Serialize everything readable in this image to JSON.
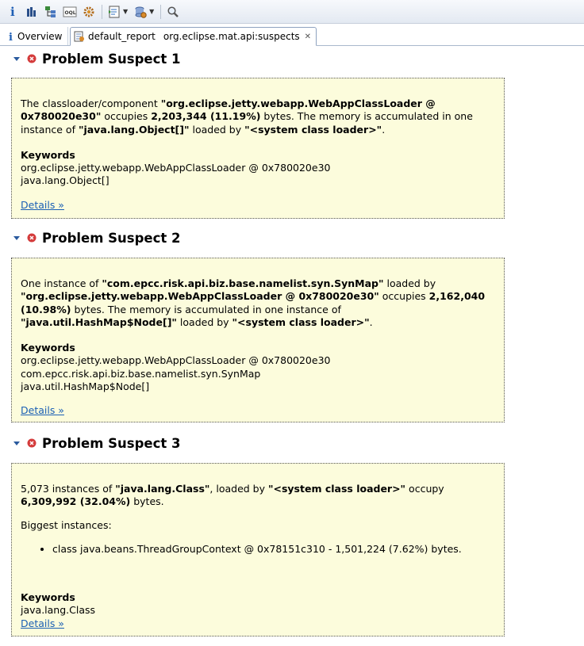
{
  "toolbar": {
    "icons": [
      "info-icon",
      "histogram-icon",
      "dominator-tree-icon",
      "oql-icon",
      "gear-icon",
      "query-browser-icon",
      "heap-dump-icon",
      "search-icon"
    ]
  },
  "tabs": {
    "overview": "Overview",
    "active": {
      "label": "default_report",
      "sublabel": "org.eclipse.mat.api:suspects"
    }
  },
  "suspects": [
    {
      "title": "Problem Suspect 1",
      "desc": [
        {
          "t": "The classloader/component ",
          "b": false
        },
        {
          "t": "\"org.eclipse.jetty.webapp.WebAppClassLoader @ 0x780020e30\"",
          "b": true
        },
        {
          "t": " occupies ",
          "b": false
        },
        {
          "t": "2,203,344 (11.19%)",
          "b": true
        },
        {
          "t": " bytes. The memory is accumulated in one instance of ",
          "b": false
        },
        {
          "t": "\"java.lang.Object[]\"",
          "b": true
        },
        {
          "t": " loaded by ",
          "b": false
        },
        {
          "t": "\"<system class loader>\"",
          "b": true
        },
        {
          "t": ".",
          "b": false
        }
      ],
      "keywords_title": "Keywords",
      "keywords": [
        "org.eclipse.jetty.webapp.WebAppClassLoader @ 0x780020e30",
        "java.lang.Object[]"
      ],
      "details": "Details »"
    },
    {
      "title": "Problem Suspect 2",
      "desc": [
        {
          "t": "One instance of ",
          "b": false
        },
        {
          "t": "\"com.epcc.risk.api.biz.base.namelist.syn.SynMap\"",
          "b": true
        },
        {
          "t": " loaded by ",
          "b": false
        },
        {
          "t": "\"org.eclipse.jetty.webapp.WebAppClassLoader @ 0x780020e30\"",
          "b": true
        },
        {
          "t": " occupies ",
          "b": false
        },
        {
          "t": "2,162,040 (10.98%)",
          "b": true
        },
        {
          "t": " bytes. The memory is accumulated in one instance of ",
          "b": false
        },
        {
          "t": "\"java.util.HashMap$Node[]\"",
          "b": true
        },
        {
          "t": " loaded by ",
          "b": false
        },
        {
          "t": "\"<system class loader>\"",
          "b": true
        },
        {
          "t": ".",
          "b": false
        }
      ],
      "keywords_title": "Keywords",
      "keywords": [
        "org.eclipse.jetty.webapp.WebAppClassLoader @ 0x780020e30",
        "com.epcc.risk.api.biz.base.namelist.syn.SynMap",
        "java.util.HashMap$Node[]"
      ],
      "details": "Details »"
    },
    {
      "title": "Problem Suspect 3",
      "desc": [
        {
          "t": "5,073 instances of ",
          "b": false
        },
        {
          "t": "\"java.lang.Class\"",
          "b": true
        },
        {
          "t": ", loaded by ",
          "b": false
        },
        {
          "t": "\"<system class loader>\"",
          "b": true
        },
        {
          "t": " occupy ",
          "b": false
        },
        {
          "t": "6,309,992 (32.04%)",
          "b": true
        },
        {
          "t": " bytes.",
          "b": false
        }
      ],
      "biggest_title": "Biggest instances:",
      "biggest": [
        "class java.beans.ThreadGroupContext @ 0x78151c310 - 1,501,224 (7.62%) bytes."
      ],
      "keywords_title": "Keywords",
      "keywords": [
        "java.lang.Class"
      ],
      "details": "Details »"
    }
  ]
}
